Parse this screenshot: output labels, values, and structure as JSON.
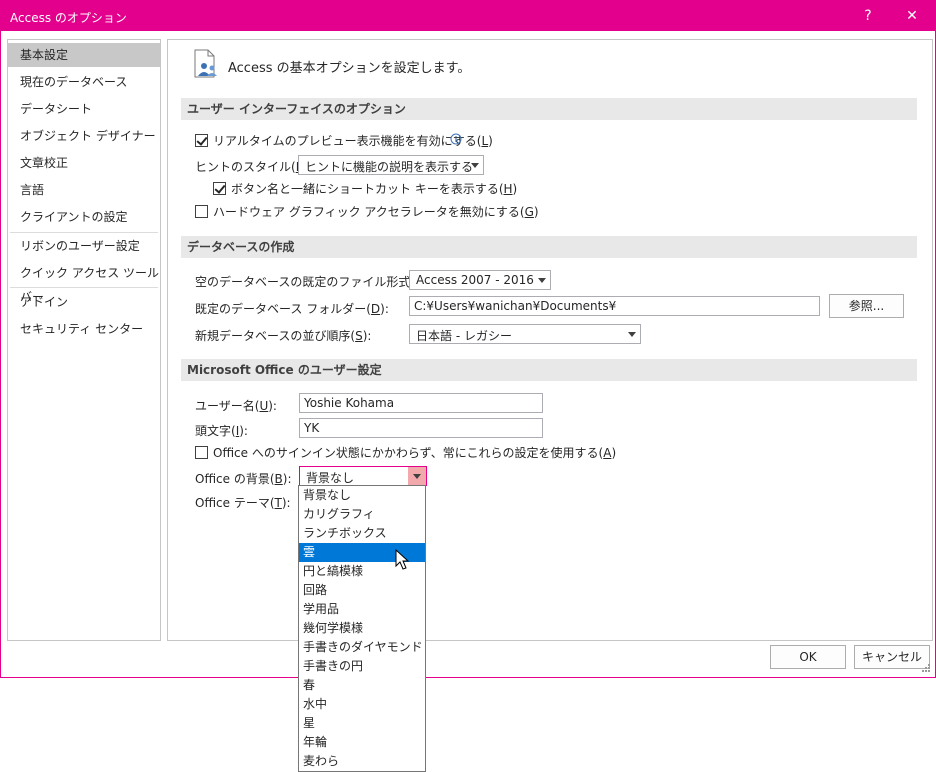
{
  "window": {
    "title": "Access のオプション",
    "help": "?",
    "close": "✕"
  },
  "nav": {
    "items": [
      {
        "label": "基本設定",
        "selected": true
      },
      {
        "label": "現在のデータベース"
      },
      {
        "label": "データシート"
      },
      {
        "label": "オブジェクト デザイナー"
      },
      {
        "label": "文章校正"
      },
      {
        "label": "言語"
      },
      {
        "label": "クライアントの設定"
      },
      {
        "label": "リボンのユーザー設定"
      },
      {
        "label": "クイック アクセス ツール バー"
      },
      {
        "label": "アドイン"
      },
      {
        "label": "セキュリティ センター"
      }
    ]
  },
  "header": {
    "text": "Access の基本オプションを設定します。",
    "icon": "options-person-icon"
  },
  "ui_section": {
    "title": "ユーザー インターフェイスのオプション",
    "realtime_preview": {
      "label": "リアルタイムのプレビュー表示機能を有効にする(",
      "key": "L",
      "close": ")",
      "checked": true
    },
    "tooltip_style": {
      "label": "ヒントのスタイル(",
      "key": "R",
      "close": "):",
      "value": "ヒントに機能の説明を表示する"
    },
    "shortcut_keys": {
      "label": "ボタン名と一緒にショートカット キーを表示する(",
      "key": "H",
      "close": ")",
      "checked": true
    },
    "hw_accel": {
      "label": "ハードウェア グラフィック アクセラレータを無効にする(",
      "key": "G",
      "close": ")",
      "checked": false
    }
  },
  "db_section": {
    "title": "データベースの作成",
    "file_format": {
      "label": "空のデータベースの既定のファイル形式(",
      "key": "F",
      "close": "):",
      "value": "Access 2007 - 2016"
    },
    "default_folder": {
      "label": "既定のデータベース フォルダー(",
      "key": "D",
      "close": "):",
      "value": "C:¥Users¥wanichan¥Documents¥",
      "browse": "参照..."
    },
    "sort_order": {
      "label": "新規データベースの並び順序(",
      "key": "S",
      "close": "):",
      "value": "日本語 - レガシー"
    }
  },
  "office_section": {
    "title": "Microsoft Office のユーザー設定",
    "username": {
      "label": "ユーザー名(",
      "key": "U",
      "close": "):",
      "value": "Yoshie Kohama"
    },
    "initials": {
      "label": "頭文字(",
      "key": "I",
      "close": "):",
      "value": "YK"
    },
    "always_use": {
      "label": "Office へのサインイン状態にかかわらず、常にこれらの設定を使用する(",
      "key": "A",
      "close": ")",
      "checked": false
    },
    "background": {
      "label": "Office の背景(",
      "key": "B",
      "close": "):",
      "value": "背景なし"
    },
    "theme": {
      "label": "Office テーマ(",
      "key": "T",
      "close": "):"
    }
  },
  "dropdown": {
    "options": [
      "背景なし",
      "カリグラフィ",
      "ランチボックス",
      "雲",
      "円と縞模様",
      "回路",
      "学用品",
      "幾何学模様",
      "手書きのダイヤモンド",
      "手書きの円",
      "春",
      "水中",
      "星",
      "年輪",
      "麦わら"
    ],
    "highlighted_index": 3
  },
  "footer": {
    "ok": "OK",
    "cancel": "キャンセル"
  },
  "colors": {
    "accent": "#e3008c",
    "selection": "#0078d7"
  }
}
